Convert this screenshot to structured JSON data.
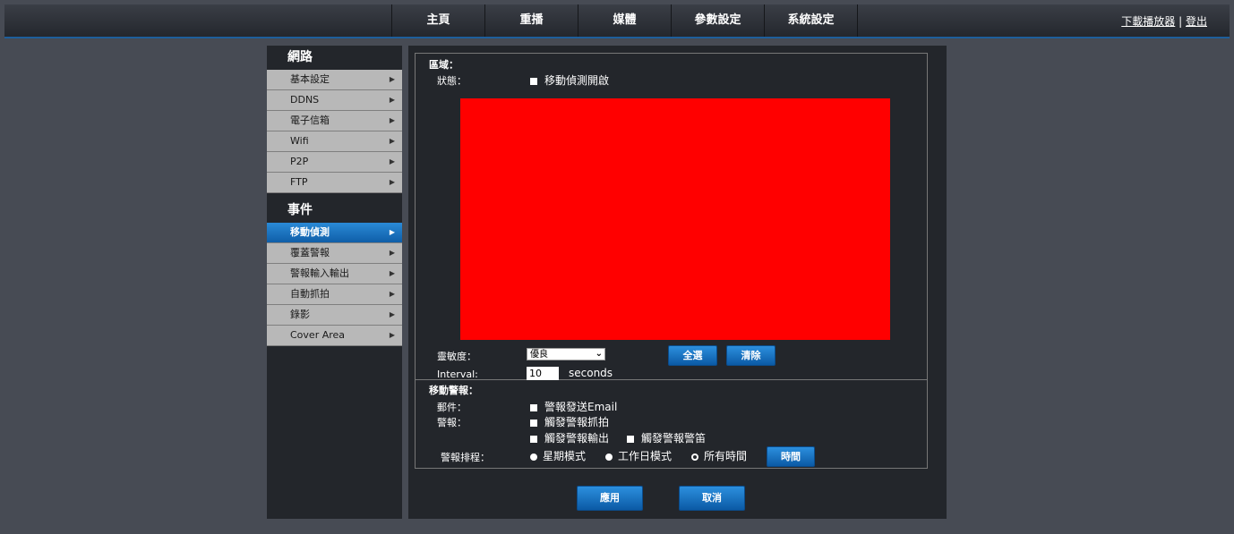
{
  "topnav": {
    "items": [
      "主頁",
      "重播",
      "媒體",
      "參數設定",
      "系統設定"
    ],
    "download_link": "下載播放器",
    "separator": "|",
    "logout_link": "登出"
  },
  "sidebar": {
    "network_title": "網路",
    "network_items": [
      "基本設定",
      "DDNS",
      "電子信箱",
      "Wifi",
      "P2P",
      "FTP"
    ],
    "event_title": "事件",
    "event_items": [
      "移動偵測",
      "覆蓋警報",
      "警報輸入輸出",
      "自動抓拍",
      "錄影",
      "Cover Area"
    ],
    "active_item": "移動偵測"
  },
  "region": {
    "title": "區域：",
    "status_label": "狀態：",
    "enable_label": "移動偵測開啟",
    "area_color": "#ff0000",
    "sensitivity_label": "靈敏度：",
    "sensitivity_value": "優良",
    "select_all_button": "全選",
    "clear_button": "清除",
    "interval_label": "Interval:",
    "interval_value": "10",
    "interval_unit": "seconds"
  },
  "alarm": {
    "title": "移動警報：",
    "mail_label": "郵件：",
    "email_option": "警報發送Email",
    "alarm_label": "警報：",
    "snapshot_option": "觸發警報抓拍",
    "output_option": "觸發警報輸出",
    "buzzer_option": "觸發警報警笛",
    "schedule_label": "警報排程：",
    "schedule_weekly": "星期模式",
    "schedule_workday": "工作日模式",
    "schedule_all": "所有時間",
    "schedule_button": "時間"
  },
  "footer": {
    "apply_button": "應用",
    "cancel_button": "取消"
  },
  "colors": {
    "accent": "#1a73c8",
    "background": "#474b54",
    "panel": "#23262b"
  }
}
